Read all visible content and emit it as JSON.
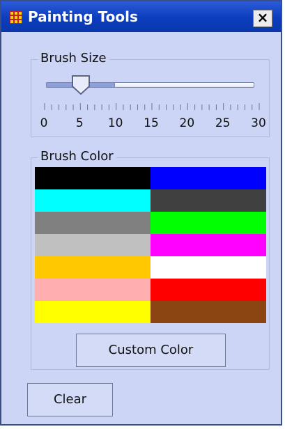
{
  "window": {
    "title": "Painting Tools",
    "close_label": "×"
  },
  "brush_size": {
    "group_label": "Brush Size",
    "min": 0,
    "max": 30,
    "value": 5,
    "tick_labels": [
      "0",
      "5",
      "10",
      "15",
      "20",
      "25",
      "30"
    ]
  },
  "brush_color": {
    "group_label": "Brush Color",
    "swatches": [
      {
        "name": "black",
        "color": "#000000"
      },
      {
        "name": "blue",
        "color": "#0000ff"
      },
      {
        "name": "cyan",
        "color": "#00ffff"
      },
      {
        "name": "dark-gray",
        "color": "#404040"
      },
      {
        "name": "gray",
        "color": "#808080"
      },
      {
        "name": "green",
        "color": "#00ff00"
      },
      {
        "name": "light-gray",
        "color": "#c0c0c0"
      },
      {
        "name": "magenta",
        "color": "#ff00ff"
      },
      {
        "name": "orange",
        "color": "#ffc800"
      },
      {
        "name": "white",
        "color": "#ffffff"
      },
      {
        "name": "pink",
        "color": "#ffafaf"
      },
      {
        "name": "red",
        "color": "#ff0000"
      },
      {
        "name": "yellow",
        "color": "#ffff00"
      },
      {
        "name": "brown",
        "color": "#8b4513"
      }
    ],
    "custom_button_label": "Custom Color"
  },
  "clear_button_label": "Clear",
  "icons": {
    "app": "grid-icon",
    "close": "close-icon",
    "slider_thumb": "slider-thumb-icon"
  }
}
